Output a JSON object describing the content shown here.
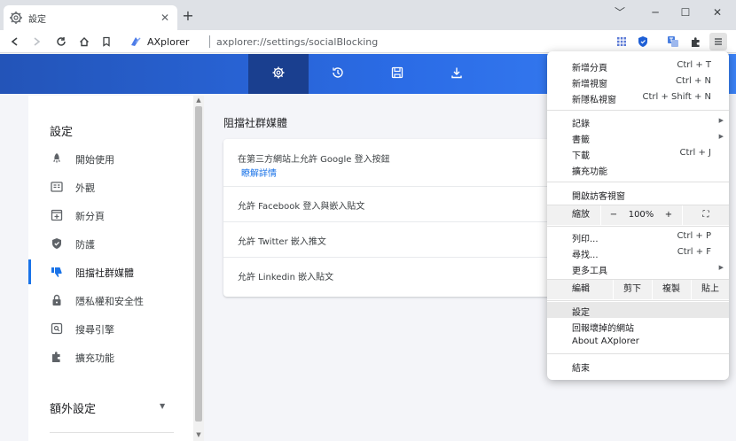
{
  "tab": {
    "title": "設定",
    "close": "✕",
    "new_tab": "+"
  },
  "window": {
    "minimize": "﹀",
    "restore": "─",
    "maximize": "☐",
    "close": "✕"
  },
  "omnibox": {
    "brand": "AXplorer",
    "url": "axplorer://settings/socialBlocking"
  },
  "sidebar": {
    "title": "設定",
    "items": [
      {
        "label": "開始使用",
        "icon": "rocket-icon"
      },
      {
        "label": "外觀",
        "icon": "appearance-icon"
      },
      {
        "label": "新分頁",
        "icon": "new-tab-icon"
      },
      {
        "label": "防護",
        "icon": "shield-icon"
      },
      {
        "label": "阻擋社群媒體",
        "icon": "thumbs-down-icon"
      },
      {
        "label": "隱私權和安全性",
        "icon": "lock-icon"
      },
      {
        "label": "搜尋引擎",
        "icon": "search-engine-icon"
      },
      {
        "label": "擴充功能",
        "icon": "puzzle-icon"
      }
    ],
    "active_index": 4,
    "extra": "額外設定",
    "extra_arrow": "▼"
  },
  "main": {
    "section_title": "阻擋社群媒體",
    "rows": [
      {
        "text": "在第三方網站上允許 Google 登入按鈕",
        "link": "瞭解詳情"
      },
      {
        "text": "允許 Facebook 登入與嵌入貼文"
      },
      {
        "text": "允許 Twitter 嵌入推文"
      },
      {
        "text": "允許 Linkedin 嵌入貼文"
      }
    ]
  },
  "menu": {
    "new_tab": {
      "label": "新增分頁",
      "shortcut": "Ctrl + T"
    },
    "new_window": {
      "label": "新增視窗",
      "shortcut": "Ctrl + N"
    },
    "new_private": {
      "label": "新隱私視窗",
      "shortcut": "Ctrl + Shift + N"
    },
    "history": {
      "label": "記錄"
    },
    "bookmarks": {
      "label": "書籤"
    },
    "downloads": {
      "label": "下載",
      "shortcut": "Ctrl + J"
    },
    "extensions": {
      "label": "擴充功能"
    },
    "guest": {
      "label": "開啟訪客視窗"
    },
    "zoom": {
      "label": "縮放",
      "minus": "−",
      "value": "100%",
      "plus": "+",
      "fullscreen": "⛶"
    },
    "print": {
      "label": "列印...",
      "shortcut": "Ctrl + P"
    },
    "find": {
      "label": "尋找...",
      "shortcut": "Ctrl + F"
    },
    "more_tools": {
      "label": "更多工具"
    },
    "edit": {
      "label": "編輯",
      "cut": "剪下",
      "copy": "複製",
      "paste": "貼上"
    },
    "settings": {
      "label": "設定"
    },
    "report": {
      "label": "回報壞掉的網站"
    },
    "about": {
      "label": "About AXplorer"
    },
    "exit": {
      "label": "結束"
    },
    "submenu_arrow": "▶"
  },
  "colors": {
    "accent": "#1a73e8",
    "hero_start": "#2354b8",
    "hero_end": "#3b82f6",
    "hero_active": "#1a3f8f"
  }
}
